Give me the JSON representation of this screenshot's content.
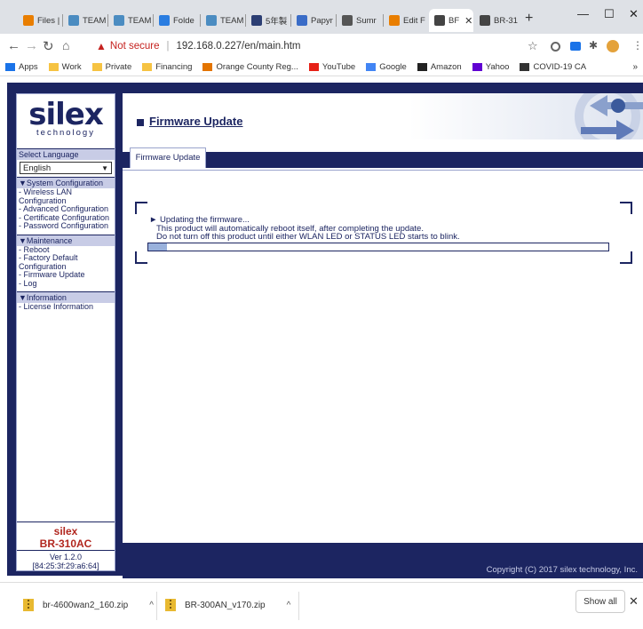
{
  "browser": {
    "tabs": [
      {
        "label": "Files |",
        "icon": "wiki-icon",
        "color": "#e97e00"
      },
      {
        "label": "TEAM",
        "icon": "team-icon",
        "color": "#4b8cc1"
      },
      {
        "label": "TEAM",
        "icon": "team-icon",
        "color": "#4b8cc1"
      },
      {
        "label": "Folde",
        "icon": "cloud-icon",
        "color": "#2a7de1"
      },
      {
        "label": "TEAM",
        "icon": "team-icon",
        "color": "#4b8cc1"
      },
      {
        "label": "5年製",
        "icon": "sheet-icon",
        "color": "#2c3e73"
      },
      {
        "label": "Papyr",
        "icon": "papyrus-icon",
        "color": "#3a6cc7"
      },
      {
        "label": "Sumr",
        "icon": "leaf-icon",
        "color": "#555555"
      },
      {
        "label": "Edit F",
        "icon": "wiki-icon",
        "color": "#e97e00"
      },
      {
        "label": "BF",
        "icon": "globe-icon",
        "color": "#444444",
        "active": true
      },
      {
        "label": "BR-31",
        "icon": "globe-icon",
        "color": "#444444"
      }
    ],
    "new_tab": "+",
    "window": {
      "minimize": "—",
      "maximize": "☐",
      "close": "✕"
    },
    "address": {
      "warning": "Not secure",
      "url": "192.168.0.227/en/main.htm"
    },
    "bookmarks": [
      {
        "label": "Apps",
        "color": "#1a73e8"
      },
      {
        "label": "Work",
        "color": "#f6c342"
      },
      {
        "label": "Private",
        "color": "#f6c342"
      },
      {
        "label": "Financing",
        "color": "#f6c342"
      },
      {
        "label": "Orange County Reg...",
        "color": "#e37400"
      },
      {
        "label": "YouTube",
        "color": "#e62117"
      },
      {
        "label": "Google",
        "color": "#4285f4"
      },
      {
        "label": "Amazon",
        "color": "#222222"
      },
      {
        "label": "Yahoo",
        "color": "#6001d2"
      },
      {
        "label": "COVID-19 CA",
        "color": "#333333"
      }
    ],
    "bookmarks_more": "»"
  },
  "sidebar": {
    "logo": "silex",
    "logo_sub": "technology",
    "select_language_label": "Select Language",
    "language": "English",
    "sections": [
      {
        "title": "▼System Configuration",
        "items": [
          "- Wireless LAN Configuration",
          "- Advanced Configuration",
          "- Certificate Configuration",
          "- Password Configuration"
        ]
      },
      {
        "title": "▼Maintenance",
        "items": [
          "- Reboot",
          "- Factory Default Configuration",
          "- Firmware Update",
          "- Log"
        ]
      },
      {
        "title": "▼Information",
        "items": [
          "- License Information"
        ]
      }
    ],
    "footer": {
      "brand": "silex",
      "model": "BR-310AC",
      "version": "Ver 1.2.0",
      "mac": "[84:25:3f:29:a6:64]"
    }
  },
  "content": {
    "page_title": "Firmware Update",
    "tab_label": "Firmware Update",
    "message": {
      "heading": "► Updating the firmware...",
      "line1": "This product will automatically reboot itself, after completing the update.",
      "line2": "Do not turn off this product until either WLAN LED or STATUS LED starts to blink."
    },
    "progress": 0.04,
    "copyright": "Copyright (C) 2017 silex technology, Inc."
  },
  "downloads": {
    "items": [
      "br-4600wan2_160.zip",
      "BR-300AN_v170.zip"
    ],
    "show_all": "Show all",
    "close": "✕"
  }
}
